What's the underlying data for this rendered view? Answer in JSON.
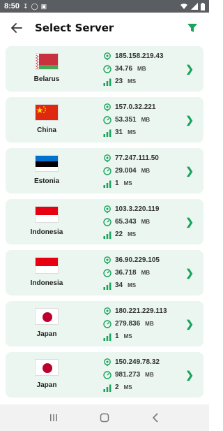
{
  "status_bar": {
    "time": "8:50",
    "left_icons": [
      "download-icon",
      "circle-icon",
      "image-icon"
    ],
    "right_icons": [
      "wifi-icon",
      "signal-icon",
      "battery-icon"
    ]
  },
  "header": {
    "title": "Select Server",
    "back_icon": "arrow-left-icon",
    "filter_icon": "filter-icon",
    "accent_color": "#1aa35b"
  },
  "servers": [
    {
      "country": "Belarus",
      "ip": "185.158.219.43",
      "speed": "34.76",
      "speed_unit": "MB",
      "ping": "23",
      "ping_unit": "MS",
      "flag": "belarus"
    },
    {
      "country": "China",
      "ip": "157.0.32.221",
      "speed": "53.351",
      "speed_unit": "MB",
      "ping": "31",
      "ping_unit": "MS",
      "flag": "china"
    },
    {
      "country": "Estonia",
      "ip": "77.247.111.50",
      "speed": "29.004",
      "speed_unit": "MB",
      "ping": "1",
      "ping_unit": "MS",
      "flag": "estonia"
    },
    {
      "country": "Indonesia",
      "ip": "103.3.220.119",
      "speed": "65.343",
      "speed_unit": "MB",
      "ping": "22",
      "ping_unit": "MS",
      "flag": "indonesia"
    },
    {
      "country": "Indonesia",
      "ip": "36.90.229.105",
      "speed": "36.718",
      "speed_unit": "MB",
      "ping": "34",
      "ping_unit": "MS",
      "flag": "indonesia"
    },
    {
      "country": "Japan",
      "ip": "180.221.229.113",
      "speed": "279.836",
      "speed_unit": "MB",
      "ping": "1",
      "ping_unit": "MS",
      "flag": "japan"
    },
    {
      "country": "Japan",
      "ip": "150.249.78.32",
      "speed": "981.273",
      "speed_unit": "MB",
      "ping": "2",
      "ping_unit": "MS",
      "flag": "japan"
    }
  ],
  "nav_bar": {
    "icons": [
      "recent-apps-icon",
      "home-icon",
      "back-icon"
    ]
  }
}
